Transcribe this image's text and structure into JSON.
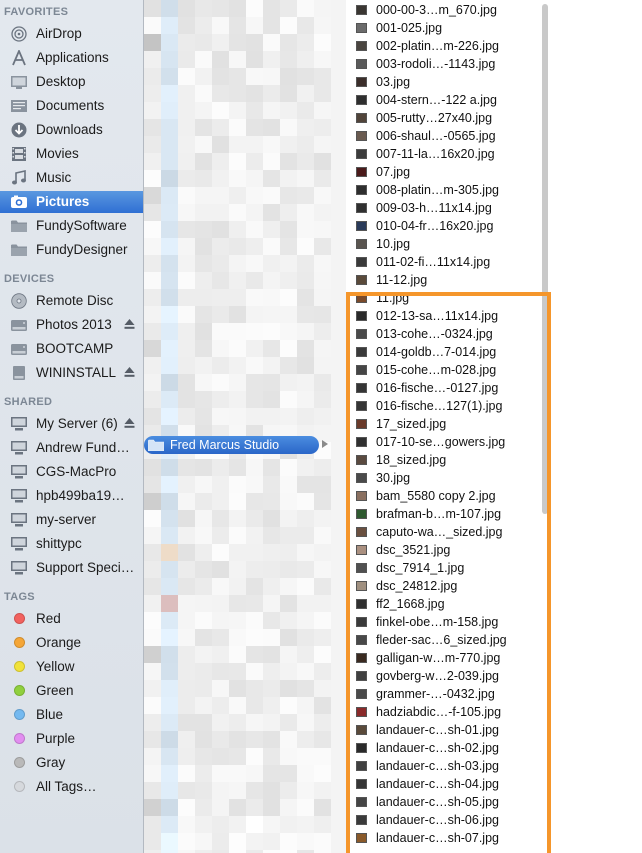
{
  "sidebar": {
    "favorites_header": "FAVORITES",
    "favorites": [
      {
        "label": "AirDrop",
        "icon": "airdrop-icon"
      },
      {
        "label": "Applications",
        "icon": "applications-icon"
      },
      {
        "label": "Desktop",
        "icon": "desktop-icon"
      },
      {
        "label": "Documents",
        "icon": "documents-icon"
      },
      {
        "label": "Downloads",
        "icon": "downloads-icon"
      },
      {
        "label": "Movies",
        "icon": "movies-icon"
      },
      {
        "label": "Music",
        "icon": "music-icon"
      },
      {
        "label": "Pictures",
        "icon": "pictures-icon",
        "selected": true
      },
      {
        "label": "FundySoftware",
        "icon": "folder-icon"
      },
      {
        "label": "FundyDesigner",
        "icon": "folder-icon"
      }
    ],
    "devices_header": "DEVICES",
    "devices": [
      {
        "label": "Remote Disc",
        "icon": "disc-icon"
      },
      {
        "label": "Photos 2013",
        "icon": "drive-icon",
        "eject": true
      },
      {
        "label": "BOOTCAMP",
        "icon": "drive-icon"
      },
      {
        "label": "WININSTALL",
        "icon": "usb-drive-icon",
        "eject": true
      }
    ],
    "shared_header": "SHARED",
    "shared": [
      {
        "label": "My Server (6)",
        "icon": "server-icon",
        "eject": true
      },
      {
        "label": "Andrew Fund…",
        "icon": "server-icon"
      },
      {
        "label": "CGS-MacPro",
        "icon": "server-icon"
      },
      {
        "label": "hpb499ba19…",
        "icon": "server-icon"
      },
      {
        "label": "my-server",
        "icon": "server-icon"
      },
      {
        "label": "shittypc",
        "icon": "server-icon"
      },
      {
        "label": "Support Speci…",
        "icon": "server-icon"
      }
    ],
    "tags_header": "TAGS",
    "tags": [
      {
        "label": "Red",
        "color": "#f2625f"
      },
      {
        "label": "Orange",
        "color": "#f5a637"
      },
      {
        "label": "Yellow",
        "color": "#f1e23a"
      },
      {
        "label": "Green",
        "color": "#90d03e"
      },
      {
        "label": "Blue",
        "color": "#74b9f0"
      },
      {
        "label": "Purple",
        "color": "#e28ef0"
      },
      {
        "label": "Gray",
        "color": "#b9b9b9"
      },
      {
        "label": "All Tags…",
        "color": "#d6d9dd"
      }
    ]
  },
  "middle": {
    "selected_folder": "Fred Marcus Studio"
  },
  "files": [
    {
      "name": "000-00-3…m_670.jpg",
      "thumb": "#3a3632"
    },
    {
      "name": "001-025.jpg",
      "thumb": "#6b6b6b"
    },
    {
      "name": "002-platin…m-226.jpg",
      "thumb": "#4a4540"
    },
    {
      "name": "003-rodoli…-1143.jpg",
      "thumb": "#5a5a5a"
    },
    {
      "name": "03.jpg",
      "thumb": "#3b2e2a"
    },
    {
      "name": "004-stern…-122 a.jpg",
      "thumb": "#2f2f2f"
    },
    {
      "name": "005-rutty…27x40.jpg",
      "thumb": "#51443a"
    },
    {
      "name": "006-shaul…-0565.jpg",
      "thumb": "#6a5b50"
    },
    {
      "name": "007-11-la…16x20.jpg",
      "thumb": "#3c3c3c"
    },
    {
      "name": "07.jpg",
      "thumb": "#4a1a1a"
    },
    {
      "name": "008-platin…m-305.jpg",
      "thumb": "#2e2e2e"
    },
    {
      "name": "009-03-h…11x14.jpg",
      "thumb": "#303030"
    },
    {
      "name": "010-04-fr…16x20.jpg",
      "thumb": "#2a3b5a"
    },
    {
      "name": "10.jpg",
      "thumb": "#5a5550"
    },
    {
      "name": "011-02-fi…11x14.jpg",
      "thumb": "#3a3a3a"
    },
    {
      "name": "11-12.jpg",
      "thumb": "#5a4a3a"
    },
    {
      "name": "11.jpg",
      "thumb": "#7a4a2a"
    },
    {
      "name": "012-13-sa…11x14.jpg",
      "thumb": "#2a2a2a"
    },
    {
      "name": "013-cohe…-0324.jpg",
      "thumb": "#4a4a4a"
    },
    {
      "name": "014-goldb…7-014.jpg",
      "thumb": "#3a3a3a"
    },
    {
      "name": "015-cohe…m-028.jpg",
      "thumb": "#454545"
    },
    {
      "name": "016-fische…-0127.jpg",
      "thumb": "#353535"
    },
    {
      "name": "016-fische…127(1).jpg",
      "thumb": "#353535"
    },
    {
      "name": "17_sized.jpg",
      "thumb": "#6a3a2a"
    },
    {
      "name": "017-10-se…gowers.jpg",
      "thumb": "#303030"
    },
    {
      "name": "18_sized.jpg",
      "thumb": "#5a4a40"
    },
    {
      "name": "30.jpg",
      "thumb": "#4a4a4a"
    },
    {
      "name": "bam_5580 copy 2.jpg",
      "thumb": "#8a7060"
    },
    {
      "name": "brafman-b…m-107.jpg",
      "thumb": "#2f5a30"
    },
    {
      "name": "caputo-wa…_sized.jpg",
      "thumb": "#6a5040"
    },
    {
      "name": "dsc_3521.jpg",
      "thumb": "#aa9080"
    },
    {
      "name": "dsc_7914_1.jpg",
      "thumb": "#505050"
    },
    {
      "name": "dsc_24812.jpg",
      "thumb": "#a09080"
    },
    {
      "name": "ff2_1668.jpg",
      "thumb": "#303030"
    },
    {
      "name": "finkel-obe…m-158.jpg",
      "thumb": "#3a3a3a"
    },
    {
      "name": "fleder-sac…6_sized.jpg",
      "thumb": "#484848"
    },
    {
      "name": "galligan-w…m-770.jpg",
      "thumb": "#3a2a20"
    },
    {
      "name": "govberg-w…2-039.jpg",
      "thumb": "#404040"
    },
    {
      "name": "grammer-…-0432.jpg",
      "thumb": "#4a4a4a"
    },
    {
      "name": "hadziabdic…-f-105.jpg",
      "thumb": "#8a2a2a"
    },
    {
      "name": "landauer-c…sh-01.jpg",
      "thumb": "#5a4a3a"
    },
    {
      "name": "landauer-c…sh-02.jpg",
      "thumb": "#2a2a2a"
    },
    {
      "name": "landauer-c…sh-03.jpg",
      "thumb": "#404040"
    },
    {
      "name": "landauer-c…sh-04.jpg",
      "thumb": "#353535"
    },
    {
      "name": "landauer-c…sh-05.jpg",
      "thumb": "#454545"
    },
    {
      "name": "landauer-c…sh-06.jpg",
      "thumb": "#3a3a3a"
    },
    {
      "name": "landauer-c…sh-07.jpg",
      "thumb": "#8a5a2a"
    }
  ],
  "colors": {
    "highlight": "#f5962b",
    "selection": "#3a7bd5"
  }
}
